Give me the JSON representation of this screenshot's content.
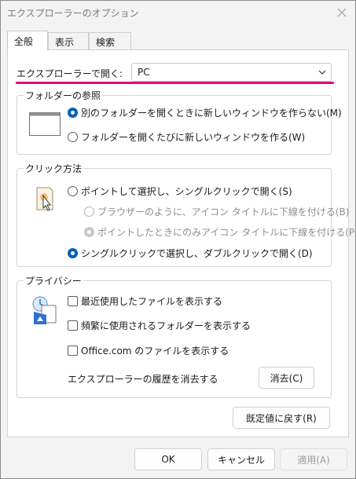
{
  "window": {
    "title": "エクスプローラーのオプション"
  },
  "tabs": [
    {
      "label": "全般",
      "active": true
    },
    {
      "label": "表示",
      "active": false
    },
    {
      "label": "検索",
      "active": false
    }
  ],
  "open_with": {
    "label": "エクスプローラーで開く:",
    "value": "PC"
  },
  "browse_folders": {
    "title": "フォルダーの参照",
    "options": [
      {
        "label": "別のフォルダーを開くときに新しいウィンドウを作らない(M)",
        "checked": true
      },
      {
        "label": "フォルダーを開くたびに新しいウィンドウを作る(W)",
        "checked": false
      }
    ]
  },
  "click_method": {
    "title": "クリック方法",
    "options": [
      {
        "label": "ポイントして選択し、シングルクリックで開く(S)",
        "checked": false
      },
      {
        "label": "ブラウザーのように、アイコン タイトルに下線を付ける(B)",
        "checked": false,
        "disabled": true
      },
      {
        "label": "ポイントしたときにのみアイコン タイトルに下線を付ける(P)",
        "checked": true,
        "disabled": true
      },
      {
        "label": "シングルクリックで選択し、ダブルクリックで開く(D)",
        "checked": true
      }
    ]
  },
  "privacy": {
    "title": "プライバシー",
    "options": [
      {
        "label": "最近使用したファイルを表示する",
        "checked": false
      },
      {
        "label": "頻繁に使用されるフォルダーを表示する",
        "checked": false
      },
      {
        "label": "Office.com のファイルを表示する",
        "checked": false
      }
    ],
    "clear_history_label": "エクスプローラーの履歴を消去する",
    "clear_button": "消去(C)"
  },
  "restore_defaults_button": "既定値に戻す(R)",
  "footer": {
    "ok": "OK",
    "cancel": "キャンセル",
    "apply": "適用(A)"
  },
  "colors": {
    "accent": "#005fb8",
    "highlight": "#e5007f"
  },
  "icons": {
    "close": "close-icon",
    "dropdown": "chevron-down-icon",
    "window": "window-icon",
    "click": "mouse-pointer-icon",
    "privacy": "privacy-icon"
  }
}
